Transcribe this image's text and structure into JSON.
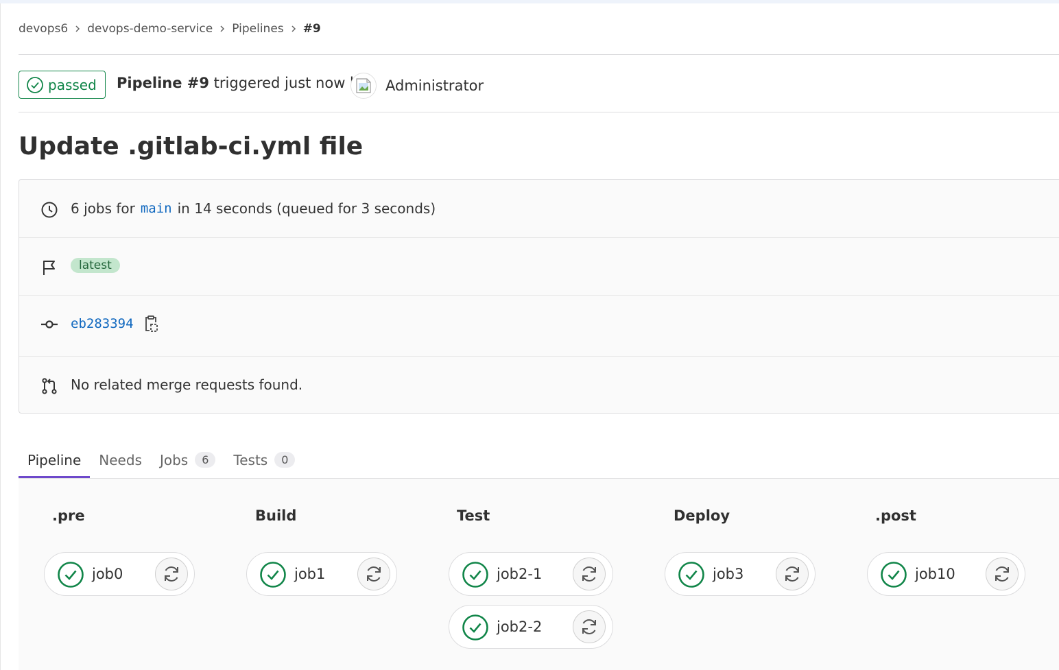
{
  "breadcrumb": {
    "items": [
      "devops6",
      "devops-demo-service",
      "Pipelines",
      "#9"
    ]
  },
  "header": {
    "status": "passed",
    "pipeline_label": "Pipeline #9",
    "triggered_text": "triggered just now by",
    "author": "Administrator"
  },
  "title": "Update .gitlab-ci.yml file",
  "info": {
    "jobs_prefix": "6 jobs for",
    "branch": "main",
    "jobs_suffix": "in 14 seconds (queued for 3 seconds)",
    "tag": "latest",
    "commit_sha": "eb283394",
    "merge_requests": "No related merge requests found."
  },
  "tabs": [
    {
      "label": "Pipeline",
      "count": null,
      "active": true
    },
    {
      "label": "Needs",
      "count": null
    },
    {
      "label": "Jobs",
      "count": "6"
    },
    {
      "label": "Tests",
      "count": "0"
    }
  ],
  "stages": [
    {
      "name": ".pre",
      "jobs": [
        "job0"
      ]
    },
    {
      "name": "Build",
      "jobs": [
        "job1"
      ]
    },
    {
      "name": "Test",
      "jobs": [
        "job2-1",
        "job2-2"
      ]
    },
    {
      "name": "Deploy",
      "jobs": [
        "job3"
      ]
    },
    {
      "name": ".post",
      "jobs": [
        "job10"
      ]
    }
  ],
  "colors": {
    "success": "#108548",
    "link": "#1068bf",
    "active_tab": "#6e49cb"
  },
  "icons": {
    "status": "check-circle-icon",
    "duration": "clock-icon",
    "tag": "flag-icon",
    "commit": "commit-icon",
    "copy": "copy-to-clipboard-icon",
    "merge_request": "merge-request-icon",
    "retry": "retry-icon"
  }
}
